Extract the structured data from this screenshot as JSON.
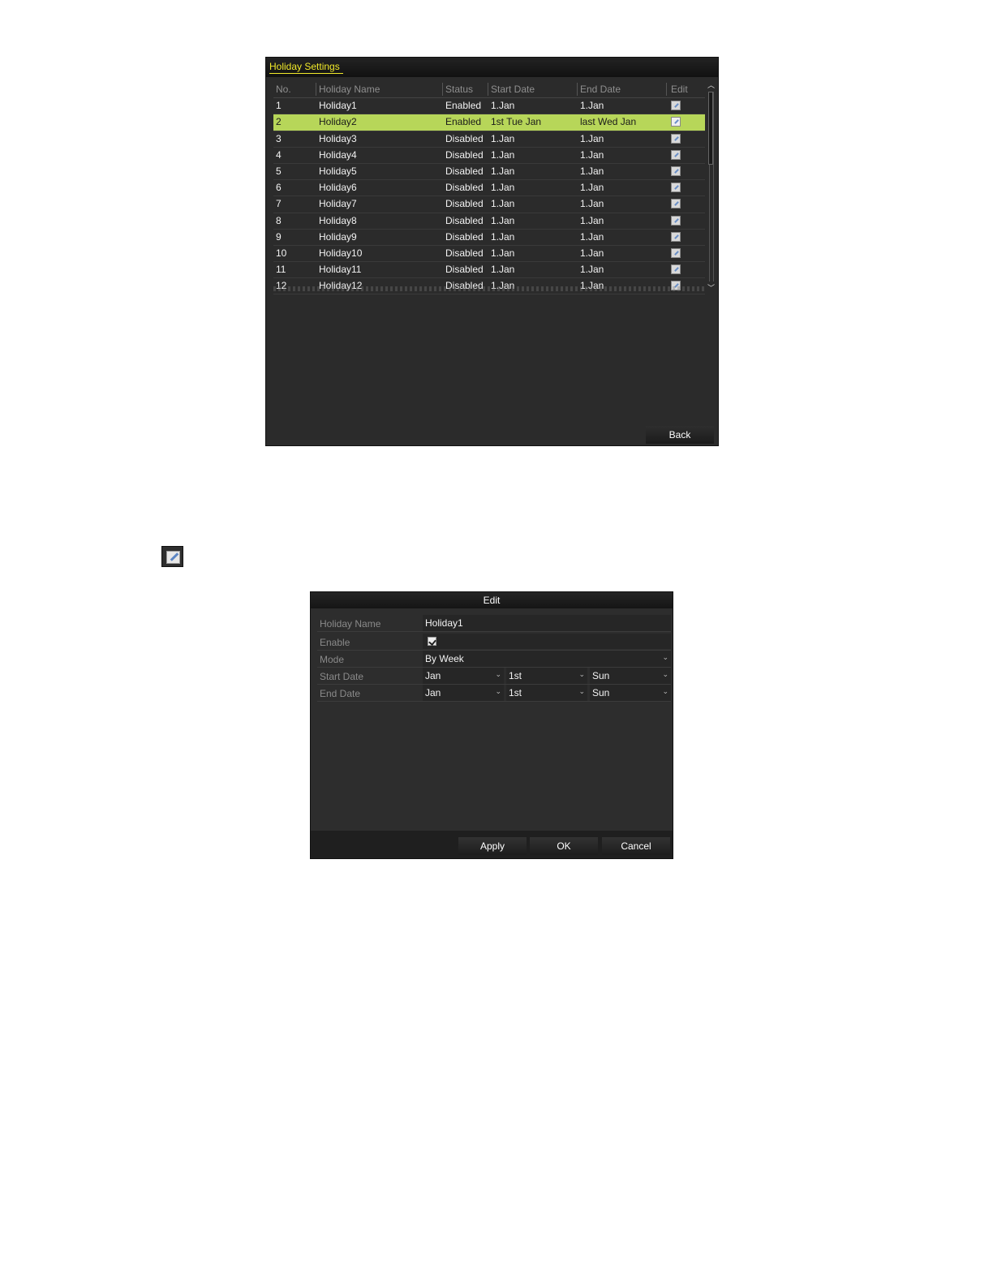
{
  "holiday_settings": {
    "title": "Holiday Settings",
    "columns": [
      "No.",
      "Holiday Name",
      "Status",
      "Start Date",
      "End Date",
      "Edit"
    ],
    "rows": [
      {
        "no": "1",
        "name": "Holiday1",
        "status": "Enabled",
        "start": "1.Jan",
        "end": "1.Jan"
      },
      {
        "no": "2",
        "name": "Holiday2",
        "status": "Enabled",
        "start": "1st Tue Jan",
        "end": "last Wed Jan"
      },
      {
        "no": "3",
        "name": "Holiday3",
        "status": "Disabled",
        "start": "1.Jan",
        "end": "1.Jan"
      },
      {
        "no": "4",
        "name": "Holiday4",
        "status": "Disabled",
        "start": "1.Jan",
        "end": "1.Jan"
      },
      {
        "no": "5",
        "name": "Holiday5",
        "status": "Disabled",
        "start": "1.Jan",
        "end": "1.Jan"
      },
      {
        "no": "6",
        "name": "Holiday6",
        "status": "Disabled",
        "start": "1.Jan",
        "end": "1.Jan"
      },
      {
        "no": "7",
        "name": "Holiday7",
        "status": "Disabled",
        "start": "1.Jan",
        "end": "1.Jan"
      },
      {
        "no": "8",
        "name": "Holiday8",
        "status": "Disabled",
        "start": "1.Jan",
        "end": "1.Jan"
      },
      {
        "no": "9",
        "name": "Holiday9",
        "status": "Disabled",
        "start": "1.Jan",
        "end": "1.Jan"
      },
      {
        "no": "10",
        "name": "Holiday10",
        "status": "Disabled",
        "start": "1.Jan",
        "end": "1.Jan"
      },
      {
        "no": "11",
        "name": "Holiday11",
        "status": "Disabled",
        "start": "1.Jan",
        "end": "1.Jan"
      },
      {
        "no": "12",
        "name": "Holiday12",
        "status": "Disabled",
        "start": "1.Jan",
        "end": "1.Jan"
      }
    ],
    "selected_row": 1,
    "back_label": "Back",
    "colors": {
      "title": "#f2ea2a",
      "selected_row": "#b7d659",
      "panel": "#2b2b2b"
    }
  },
  "standalone_icon": "edit-icon",
  "edit_dialog": {
    "title": "Edit",
    "holiday_name_label": "Holiday Name",
    "holiday_name_value": "Holiday1",
    "enable_label": "Enable",
    "enable_checked": true,
    "mode_label": "Mode",
    "mode_value": "By Week",
    "start_date_label": "Start Date",
    "start_date": {
      "month": "Jan",
      "week": "1st",
      "day": "Sun"
    },
    "end_date_label": "End Date",
    "end_date": {
      "month": "Jan",
      "week": "1st",
      "day": "Sun"
    },
    "buttons": {
      "apply": "Apply",
      "ok": "OK",
      "cancel": "Cancel"
    }
  }
}
